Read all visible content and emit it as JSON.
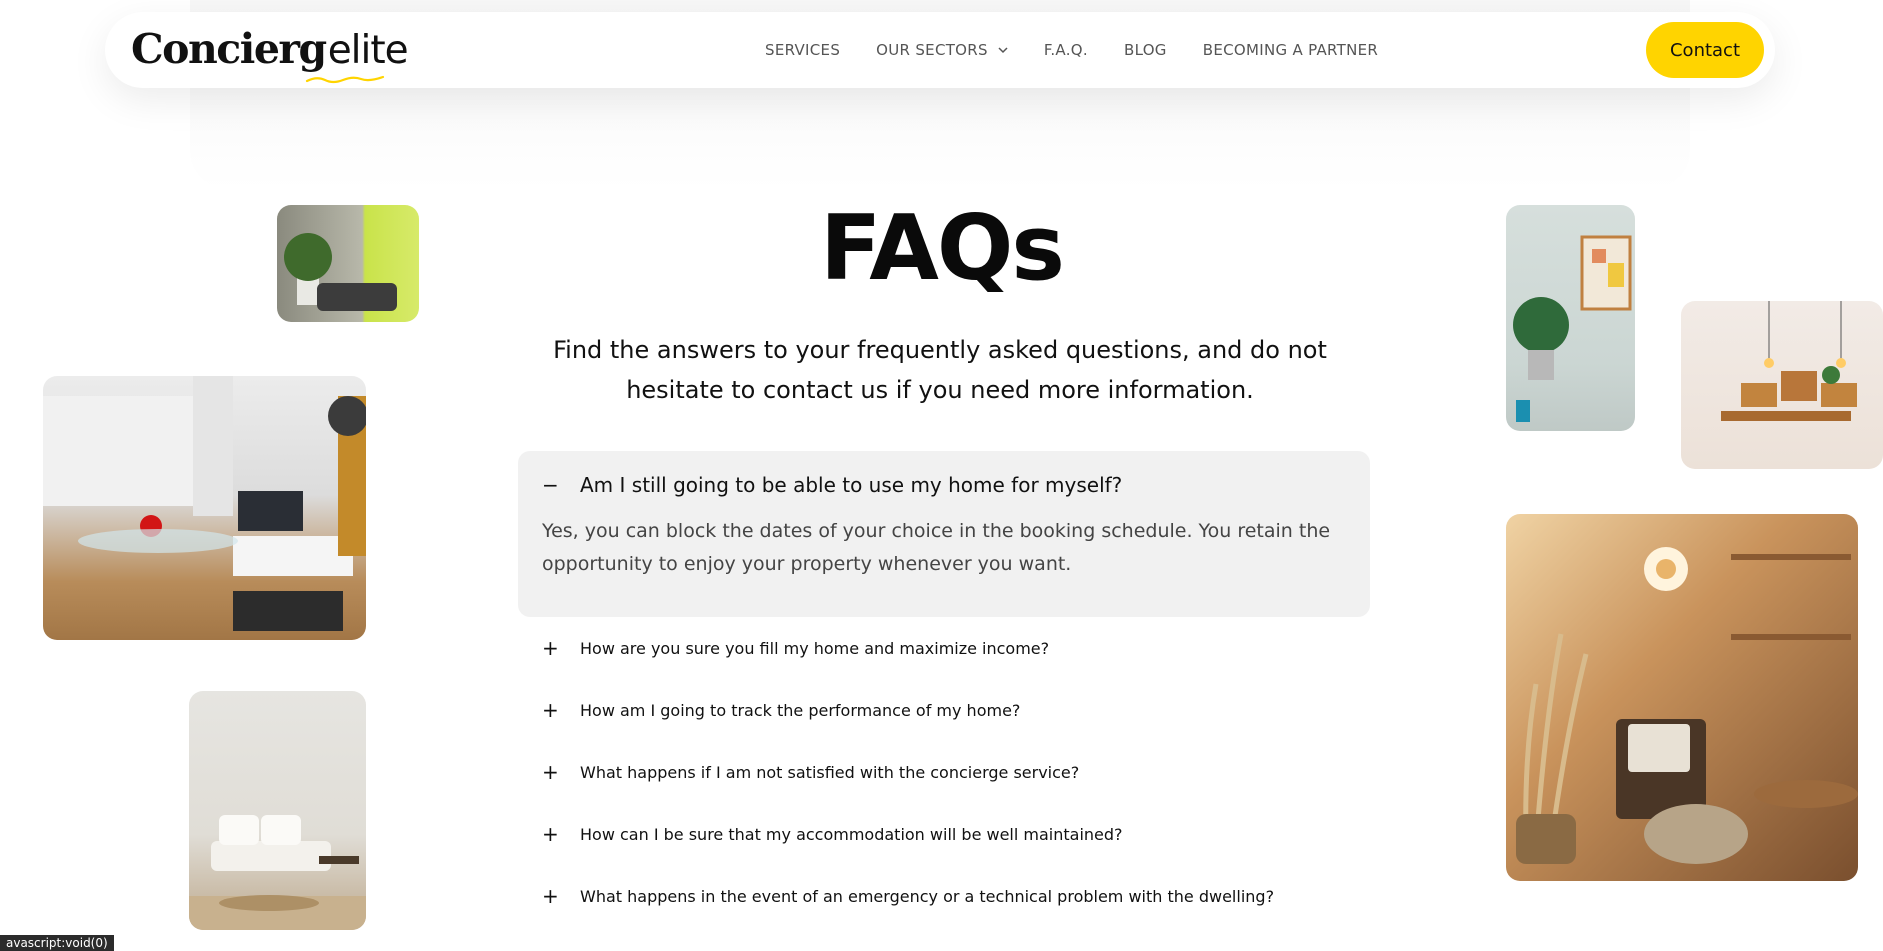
{
  "brand": {
    "name_part1": "Concierg",
    "name_part2": "elite",
    "accent": "#ffd400"
  },
  "nav": {
    "items": [
      {
        "label": "SERVICES"
      },
      {
        "label": "OUR SECTORS"
      },
      {
        "label": "F.A.Q."
      },
      {
        "label": "BLOG"
      },
      {
        "label": "BECOMING A PARTNER"
      }
    ],
    "contact_label": "Contact"
  },
  "hero": {
    "title": "FAQs",
    "subtitle": "Find the answers to your frequently asked questions, and do not hesitate to contact us if you need more information."
  },
  "faq": {
    "open": {
      "sign": "−",
      "question": "Am I still going to be able to use my home for myself?",
      "answer": "Yes, you can block the dates of your choice in the booking schedule. You retain the opportunity to enjoy your property whenever you want."
    },
    "items": [
      {
        "sign": "+",
        "question": "How are you sure you fill my home and maximize income?"
      },
      {
        "sign": "+",
        "question": "How am I going to track the performance of my home?"
      },
      {
        "sign": "+",
        "question": "What happens if I am not satisfied with the concierge service?"
      },
      {
        "sign": "+",
        "question": "How can I be sure that my accommodation will be well maintained?"
      },
      {
        "sign": "+",
        "question": "What happens in the event of an emergency or a technical problem with the dwelling?"
      }
    ]
  },
  "status_bar": {
    "text": "avascript:void(0)"
  }
}
